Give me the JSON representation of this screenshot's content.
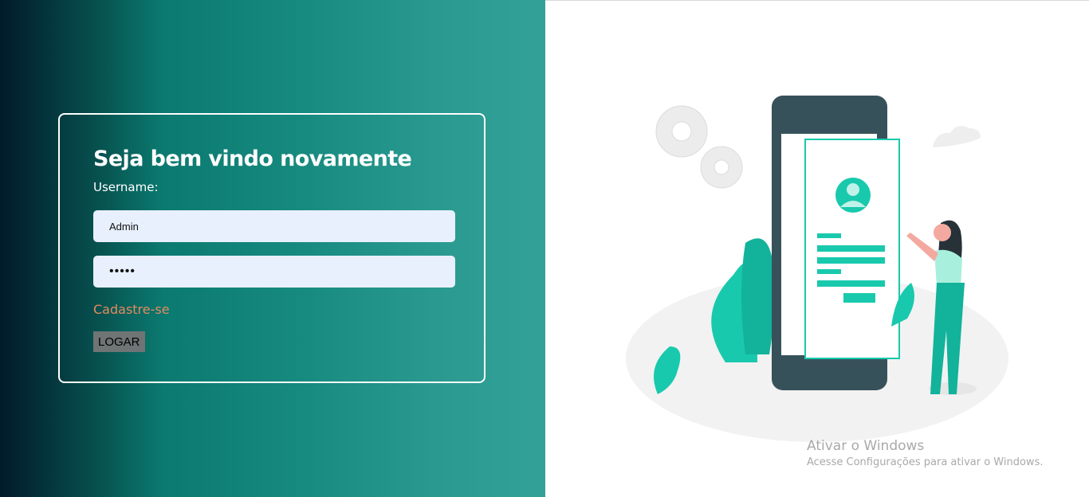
{
  "login": {
    "title": "Seja bem vindo novamente",
    "username_label": "Username:",
    "username_value": "Admin",
    "password_mask": "•••••",
    "signup_link": "Cadastre-se",
    "login_button": "LOGAR"
  },
  "watermark": {
    "title": "Ativar o Windows",
    "subtitle": "Acesse Configurações para ativar o Windows."
  },
  "colors": {
    "gradient_dark": "#021a2a",
    "gradient_teal": "#33a198",
    "input_bg": "#e8f0fe",
    "link": "#e48a5e",
    "button_bg": "#6f7475",
    "accent_green": "#19c9ad"
  },
  "illustration": {
    "icon": "person-using-phone-login-illustration"
  }
}
